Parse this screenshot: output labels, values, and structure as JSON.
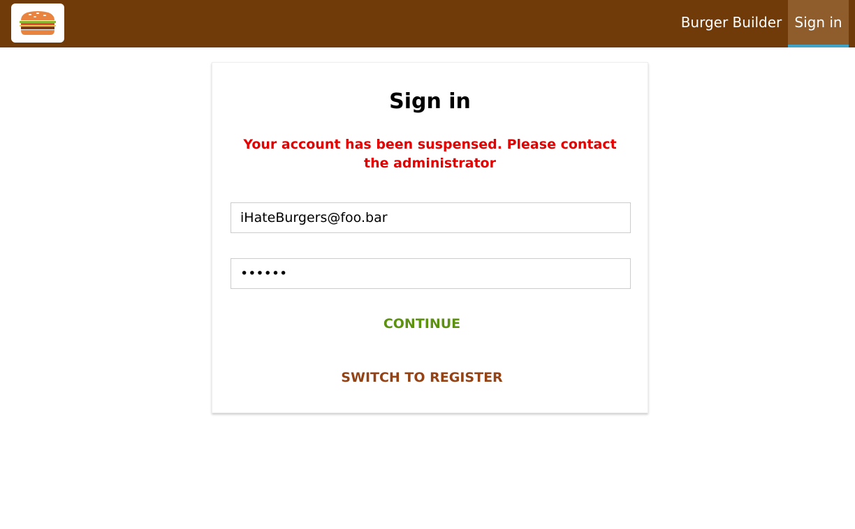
{
  "header": {
    "logo_icon": "burger-logo-icon",
    "nav_items": [
      {
        "label": "Burger Builder"
      },
      {
        "label": "Sign in",
        "active": true
      }
    ]
  },
  "auth": {
    "title": "Sign in",
    "error_message": "Your account has been suspensed. Please contact the administrator",
    "email_value": "iHateBurgers@foo.bar",
    "password_value": "••••••",
    "continue_label": "CONTINUE",
    "switch_label": "SWITCH TO REGISTER"
  },
  "colors": {
    "toolbar": "#703b09",
    "active_nav": "#8f5c2c",
    "active_underline": "#40a4c8",
    "error": "#e50000",
    "continue": "#5c9210",
    "switch": "#944317"
  }
}
